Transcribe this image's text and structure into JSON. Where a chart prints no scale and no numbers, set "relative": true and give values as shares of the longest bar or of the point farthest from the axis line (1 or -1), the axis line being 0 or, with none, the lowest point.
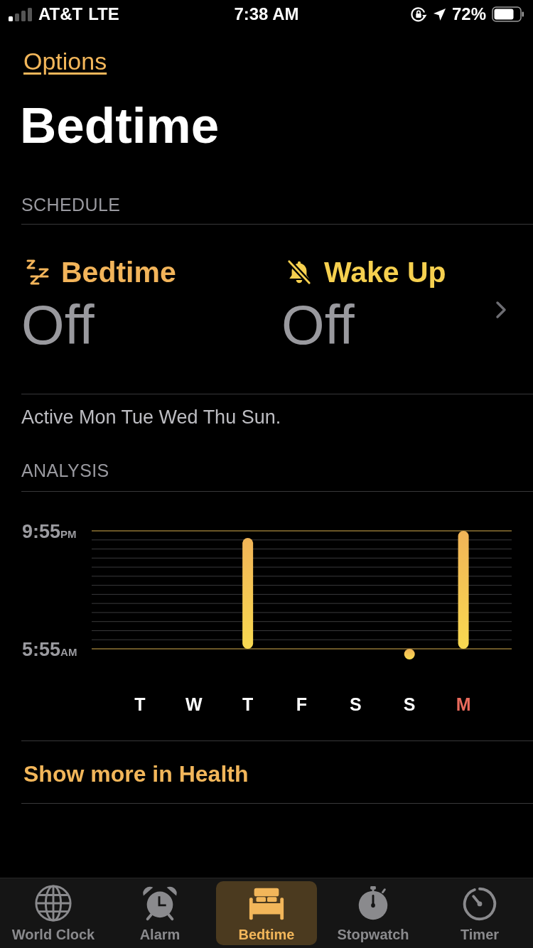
{
  "status_bar": {
    "carrier": "AT&T",
    "network": "LTE",
    "time": "7:38 AM",
    "battery": "72%"
  },
  "nav": {
    "link": "Options"
  },
  "title": "Bedtime",
  "schedule": {
    "heading": "SCHEDULE",
    "items": [
      {
        "label": "Bedtime",
        "value": "Off",
        "color": "#f2b45a"
      },
      {
        "label": "Wake Up",
        "value": "Off",
        "color": "#f6d04f"
      }
    ],
    "note": "Active Mon Tue Wed Thu Sun."
  },
  "analysis": {
    "heading": "ANALYSIS",
    "y_labels": [
      "9:55PM",
      "5:55AM"
    ],
    "chart_data": {
      "type": "bar",
      "relative": true,
      "categories": [
        "T",
        "W",
        "T",
        "F",
        "S",
        "S",
        "M"
      ],
      "ylim": [
        -0.1,
        1
      ],
      "series": [
        {
          "color": "#f1b457",
          "values": [
            null,
            null,
            0.94,
            null,
            null,
            -0.09,
            1
          ]
        }
      ]
    },
    "days": [
      {
        "today": false
      },
      {
        "today": false
      },
      {
        "today": false
      },
      {
        "today": false
      },
      {
        "today": false
      },
      {
        "today": false
      },
      {
        "today": true
      }
    ],
    "link": "Show more in Health"
  },
  "tabs": [
    {
      "label": "World Clock",
      "selected": false
    },
    {
      "label": "Alarm",
      "selected": false
    },
    {
      "label": "Bedtime",
      "selected": true
    },
    {
      "label": "Stopwatch",
      "selected": false
    },
    {
      "label": "Timer",
      "selected": false
    }
  ]
}
